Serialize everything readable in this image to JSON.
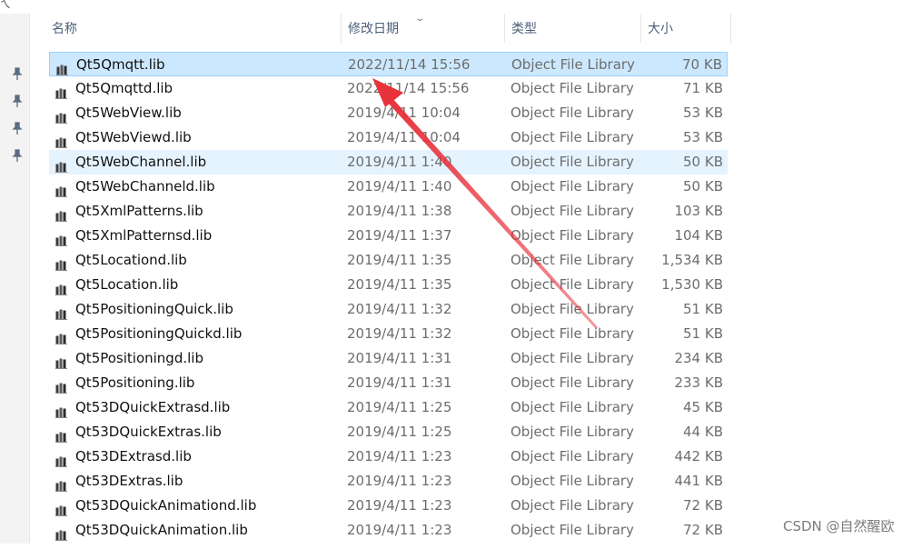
{
  "header": {
    "name": "名称",
    "date": "修改日期",
    "type": "类型",
    "size": "大小"
  },
  "files": [
    {
      "name": "Qt5Qmqtt.lib",
      "date": "2022/11/14 15:56",
      "type": "Object File Library",
      "size": "70 KB",
      "state": "selected"
    },
    {
      "name": "Qt5Qmqttd.lib",
      "date": "2022/11/14 15:56",
      "type": "Object File Library",
      "size": "71 KB",
      "state": ""
    },
    {
      "name": "Qt5WebView.lib",
      "date": "2019/4/11 10:04",
      "type": "Object File Library",
      "size": "53 KB",
      "state": ""
    },
    {
      "name": "Qt5WebViewd.lib",
      "date": "2019/4/11 10:04",
      "type": "Object File Library",
      "size": "53 KB",
      "state": ""
    },
    {
      "name": "Qt5WebChannel.lib",
      "date": "2019/4/11 1:40",
      "type": "Object File Library",
      "size": "50 KB",
      "state": "hovered"
    },
    {
      "name": "Qt5WebChanneld.lib",
      "date": "2019/4/11 1:40",
      "type": "Object File Library",
      "size": "50 KB",
      "state": ""
    },
    {
      "name": "Qt5XmlPatterns.lib",
      "date": "2019/4/11 1:38",
      "type": "Object File Library",
      "size": "103 KB",
      "state": ""
    },
    {
      "name": "Qt5XmlPatternsd.lib",
      "date": "2019/4/11 1:37",
      "type": "Object File Library",
      "size": "104 KB",
      "state": ""
    },
    {
      "name": "Qt5Locationd.lib",
      "date": "2019/4/11 1:35",
      "type": "Object File Library",
      "size": "1,534 KB",
      "state": ""
    },
    {
      "name": "Qt5Location.lib",
      "date": "2019/4/11 1:35",
      "type": "Object File Library",
      "size": "1,530 KB",
      "state": ""
    },
    {
      "name": "Qt5PositioningQuick.lib",
      "date": "2019/4/11 1:32",
      "type": "Object File Library",
      "size": "51 KB",
      "state": ""
    },
    {
      "name": "Qt5PositioningQuickd.lib",
      "date": "2019/4/11 1:32",
      "type": "Object File Library",
      "size": "51 KB",
      "state": ""
    },
    {
      "name": "Qt5Positioningd.lib",
      "date": "2019/4/11 1:31",
      "type": "Object File Library",
      "size": "234 KB",
      "state": ""
    },
    {
      "name": "Qt5Positioning.lib",
      "date": "2019/4/11 1:31",
      "type": "Object File Library",
      "size": "233 KB",
      "state": ""
    },
    {
      "name": "Qt53DQuickExtrasd.lib",
      "date": "2019/4/11 1:25",
      "type": "Object File Library",
      "size": "45 KB",
      "state": ""
    },
    {
      "name": "Qt53DQuickExtras.lib",
      "date": "2019/4/11 1:25",
      "type": "Object File Library",
      "size": "44 KB",
      "state": ""
    },
    {
      "name": "Qt53DExtrasd.lib",
      "date": "2019/4/11 1:23",
      "type": "Object File Library",
      "size": "442 KB",
      "state": ""
    },
    {
      "name": "Qt53DExtras.lib",
      "date": "2019/4/11 1:23",
      "type": "Object File Library",
      "size": "441 KB",
      "state": ""
    },
    {
      "name": "Qt53DQuickAnimationd.lib",
      "date": "2019/4/11 1:23",
      "type": "Object File Library",
      "size": "72 KB",
      "state": ""
    },
    {
      "name": "Qt53DQuickAnimation.lib",
      "date": "2019/4/11 1:23",
      "type": "Object File Library",
      "size": "72 KB",
      "state": ""
    }
  ],
  "icons": {
    "file": "library-file-icon",
    "pin": "pin-icon",
    "sort": "chevron-down-icon"
  },
  "colors": {
    "selected_bg": "#cce8ff",
    "selected_border": "#99d1ff",
    "hover_bg": "#e5f3ff",
    "arrow": "#e8323c",
    "header_text": "#4c607a"
  },
  "watermark": "CSDN @自然醒欧"
}
